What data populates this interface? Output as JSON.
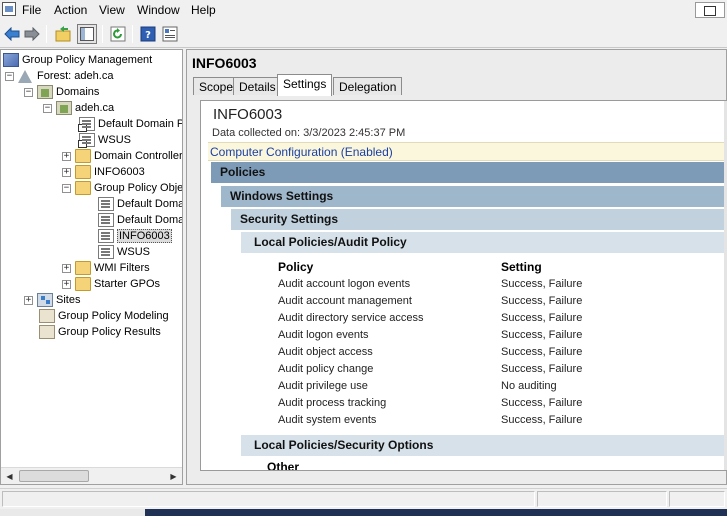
{
  "menubar": {
    "items": [
      "File",
      "Action",
      "View",
      "Window",
      "Help"
    ]
  },
  "toolbar": {
    "buttons": [
      "back-arrow-icon",
      "forward-arrow-icon",
      "up-folder-icon",
      "show-hide-tree-icon",
      "refresh-icon",
      "help-icon",
      "properties-icon"
    ]
  },
  "tree": {
    "root": "Group Policy Management",
    "forest": "Forest: adeh.ca",
    "domains": "Domains",
    "domain": "adeh.ca",
    "default_domain_link": "Default Domain Po",
    "wsus_link": "WSUS",
    "domain_controllers": "Domain Controller",
    "info6003_ou": "INFO6003",
    "gpo_folder": "Group Policy Obje",
    "gpo_default1": "Default Doma",
    "gpo_default2": "Default Doma",
    "gpo_info6003": "INFO6003",
    "gpo_wsus": "WSUS",
    "wmi_filters": "WMI Filters",
    "starter_gpos": "Starter GPOs",
    "sites": "Sites",
    "modeling": "Group Policy Modeling",
    "results": "Group Policy Results"
  },
  "details": {
    "title": "INFO6003",
    "tabs": [
      "Scope",
      "Details",
      "Settings",
      "Delegation"
    ],
    "active_tab": "Settings"
  },
  "report": {
    "gpo_name": "INFO6003",
    "data_collected": "Data collected on: 3/3/2023 2:45:37 PM",
    "computer_config": "Computer Configuration (Enabled)",
    "policies": "Policies",
    "windows_settings": "Windows Settings",
    "security_settings": "Security Settings",
    "audit_policy_header": "Local Policies/Audit Policy",
    "col_policy": "Policy",
    "col_setting": "Setting",
    "rows": [
      {
        "policy": "Audit account logon events",
        "setting": "Success, Failure"
      },
      {
        "policy": "Audit account management",
        "setting": "Success, Failure"
      },
      {
        "policy": "Audit directory service access",
        "setting": "Success, Failure"
      },
      {
        "policy": "Audit logon events",
        "setting": "Success, Failure"
      },
      {
        "policy": "Audit object access",
        "setting": "Success, Failure"
      },
      {
        "policy": "Audit policy change",
        "setting": "Success, Failure"
      },
      {
        "policy": "Audit privilege use",
        "setting": "No auditing"
      },
      {
        "policy": "Audit process tracking",
        "setting": "Success, Failure"
      },
      {
        "policy": "Audit system events",
        "setting": "Success, Failure"
      }
    ],
    "security_options_header": "Local Policies/Security Options",
    "other": "Other"
  },
  "colors": {
    "policies_band": "#7d9bb6",
    "windows_band": "#9fb7cb",
    "security_band": "#c1d2de",
    "local_band": "#d6e1e9",
    "computer_config_text": "#1a3fa6"
  }
}
